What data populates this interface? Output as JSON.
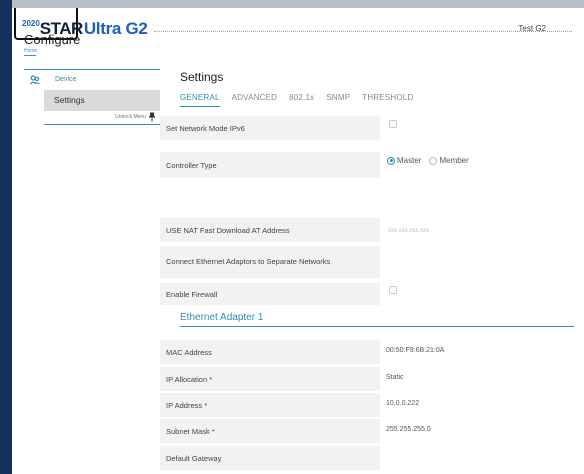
{
  "app": {
    "brand_mark": "2020",
    "brand_star": "STAR",
    "brand_product": "Ultra G2",
    "device_name": "Test G2"
  },
  "page": {
    "title": "Configure",
    "breadcrumb": "Home"
  },
  "sidebar": {
    "device_label": "Device",
    "settings_label": "Settings",
    "undock_label": "Undock Menu"
  },
  "content": {
    "title": "Settings",
    "tabs": [
      "GENERAL",
      "ADVANCED",
      "802.1x",
      "SNMP",
      "THRESHOLD"
    ],
    "active_tab": "GENERAL"
  },
  "fields": {
    "ipv6_label": "Set Network Mode IPv6",
    "controller_label": "Controller Type",
    "controller_options": [
      "Master",
      "Member"
    ],
    "controller_selected": "Master",
    "nat_label": "USE NAT Fast Download AT Address",
    "nat_placeholder": "xxx.xxx.xxx.xxx",
    "separate_label": "Connect Ethernet Adaptors to Separate Networks",
    "firewall_label": "Enable Firewall"
  },
  "ethernet": {
    "heading": "Ethernet Adapter 1",
    "mac_label": "MAC Address",
    "mac_value": "00:50:F9:6B:21:0A",
    "alloc_label": "IP Allocation *",
    "alloc_value": "Static",
    "ip_label": "IP Address *",
    "ip_value": "10.0.0.222",
    "mask_label": "Subnet Mask *",
    "mask_value": "255.255.255.0",
    "gateway_label": "Default Gateway"
  },
  "colors": {
    "accent": "#2f8fb0",
    "brand_blue": "#1f5fbf",
    "nav_dark": "#16305f"
  }
}
